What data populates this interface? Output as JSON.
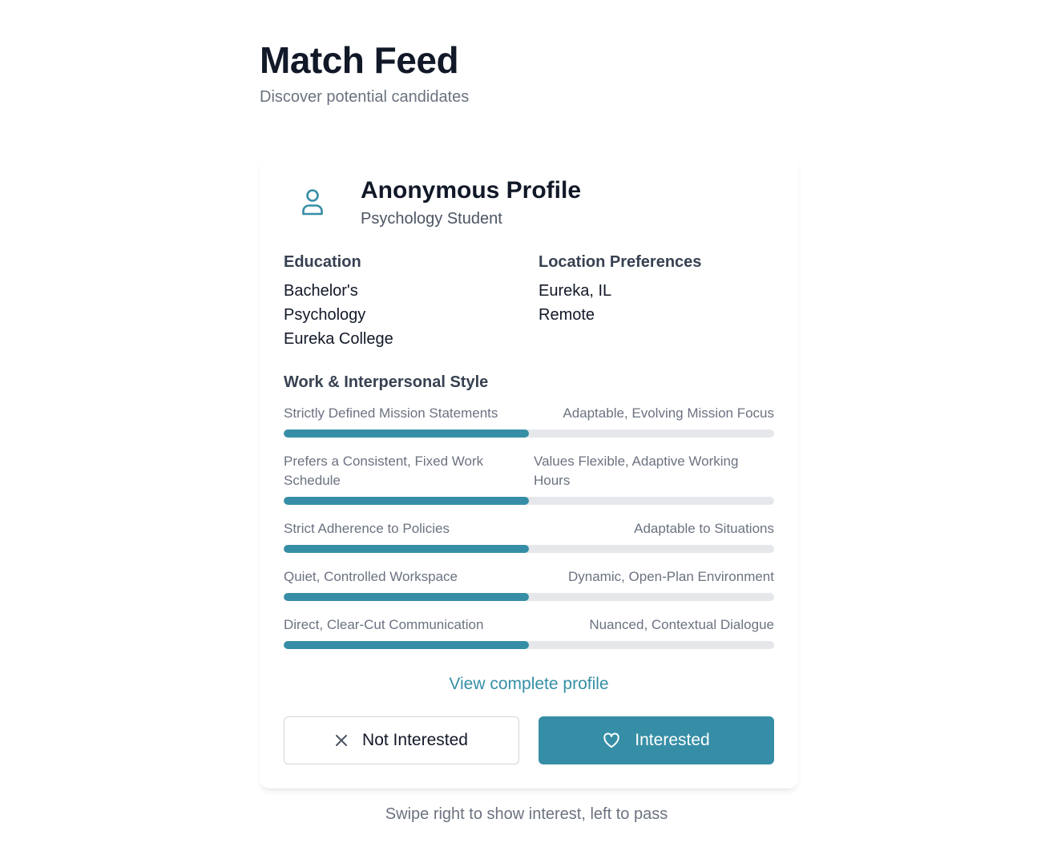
{
  "header": {
    "title": "Match Feed",
    "subtitle": "Discover potential candidates"
  },
  "profile": {
    "avatar_icon": "user-icon",
    "name": "Anonymous Profile",
    "role": "Psychology Student"
  },
  "education": {
    "heading": "Education",
    "items": [
      "Bachelor's",
      "Psychology",
      "Eureka College"
    ]
  },
  "location": {
    "heading": "Location Preferences",
    "items": [
      "Eureka, IL",
      "Remote"
    ]
  },
  "style": {
    "heading": "Work & Interpersonal Style",
    "sliders": [
      {
        "left": "Strictly Defined Mission Statements",
        "right": "Adaptable, Evolving Mission Focus",
        "value_percent": 50
      },
      {
        "left": "Prefers a Consistent, Fixed Work Schedule",
        "right": "Values Flexible, Adaptive Working Hours",
        "value_percent": 50
      },
      {
        "left": "Strict Adherence to Policies",
        "right": "Adaptable to Situations",
        "value_percent": 50
      },
      {
        "left": "Quiet, Controlled Workspace",
        "right": "Dynamic, Open-Plan Environment",
        "value_percent": 50
      },
      {
        "left": "Direct, Clear-Cut Communication",
        "right": "Nuanced, Contextual Dialogue",
        "value_percent": 50
      }
    ]
  },
  "actions": {
    "view_profile": "View complete profile",
    "not_interested": "Not Interested",
    "not_interested_icon": "close-icon",
    "interested": "Interested",
    "interested_icon": "heart-icon"
  },
  "footer": {
    "hint": "Swipe right to show interest, left to pass"
  },
  "colors": {
    "accent": "#368ea6",
    "track": "#e5e7eb",
    "text_primary": "#111827",
    "text_muted": "#6b7280"
  }
}
